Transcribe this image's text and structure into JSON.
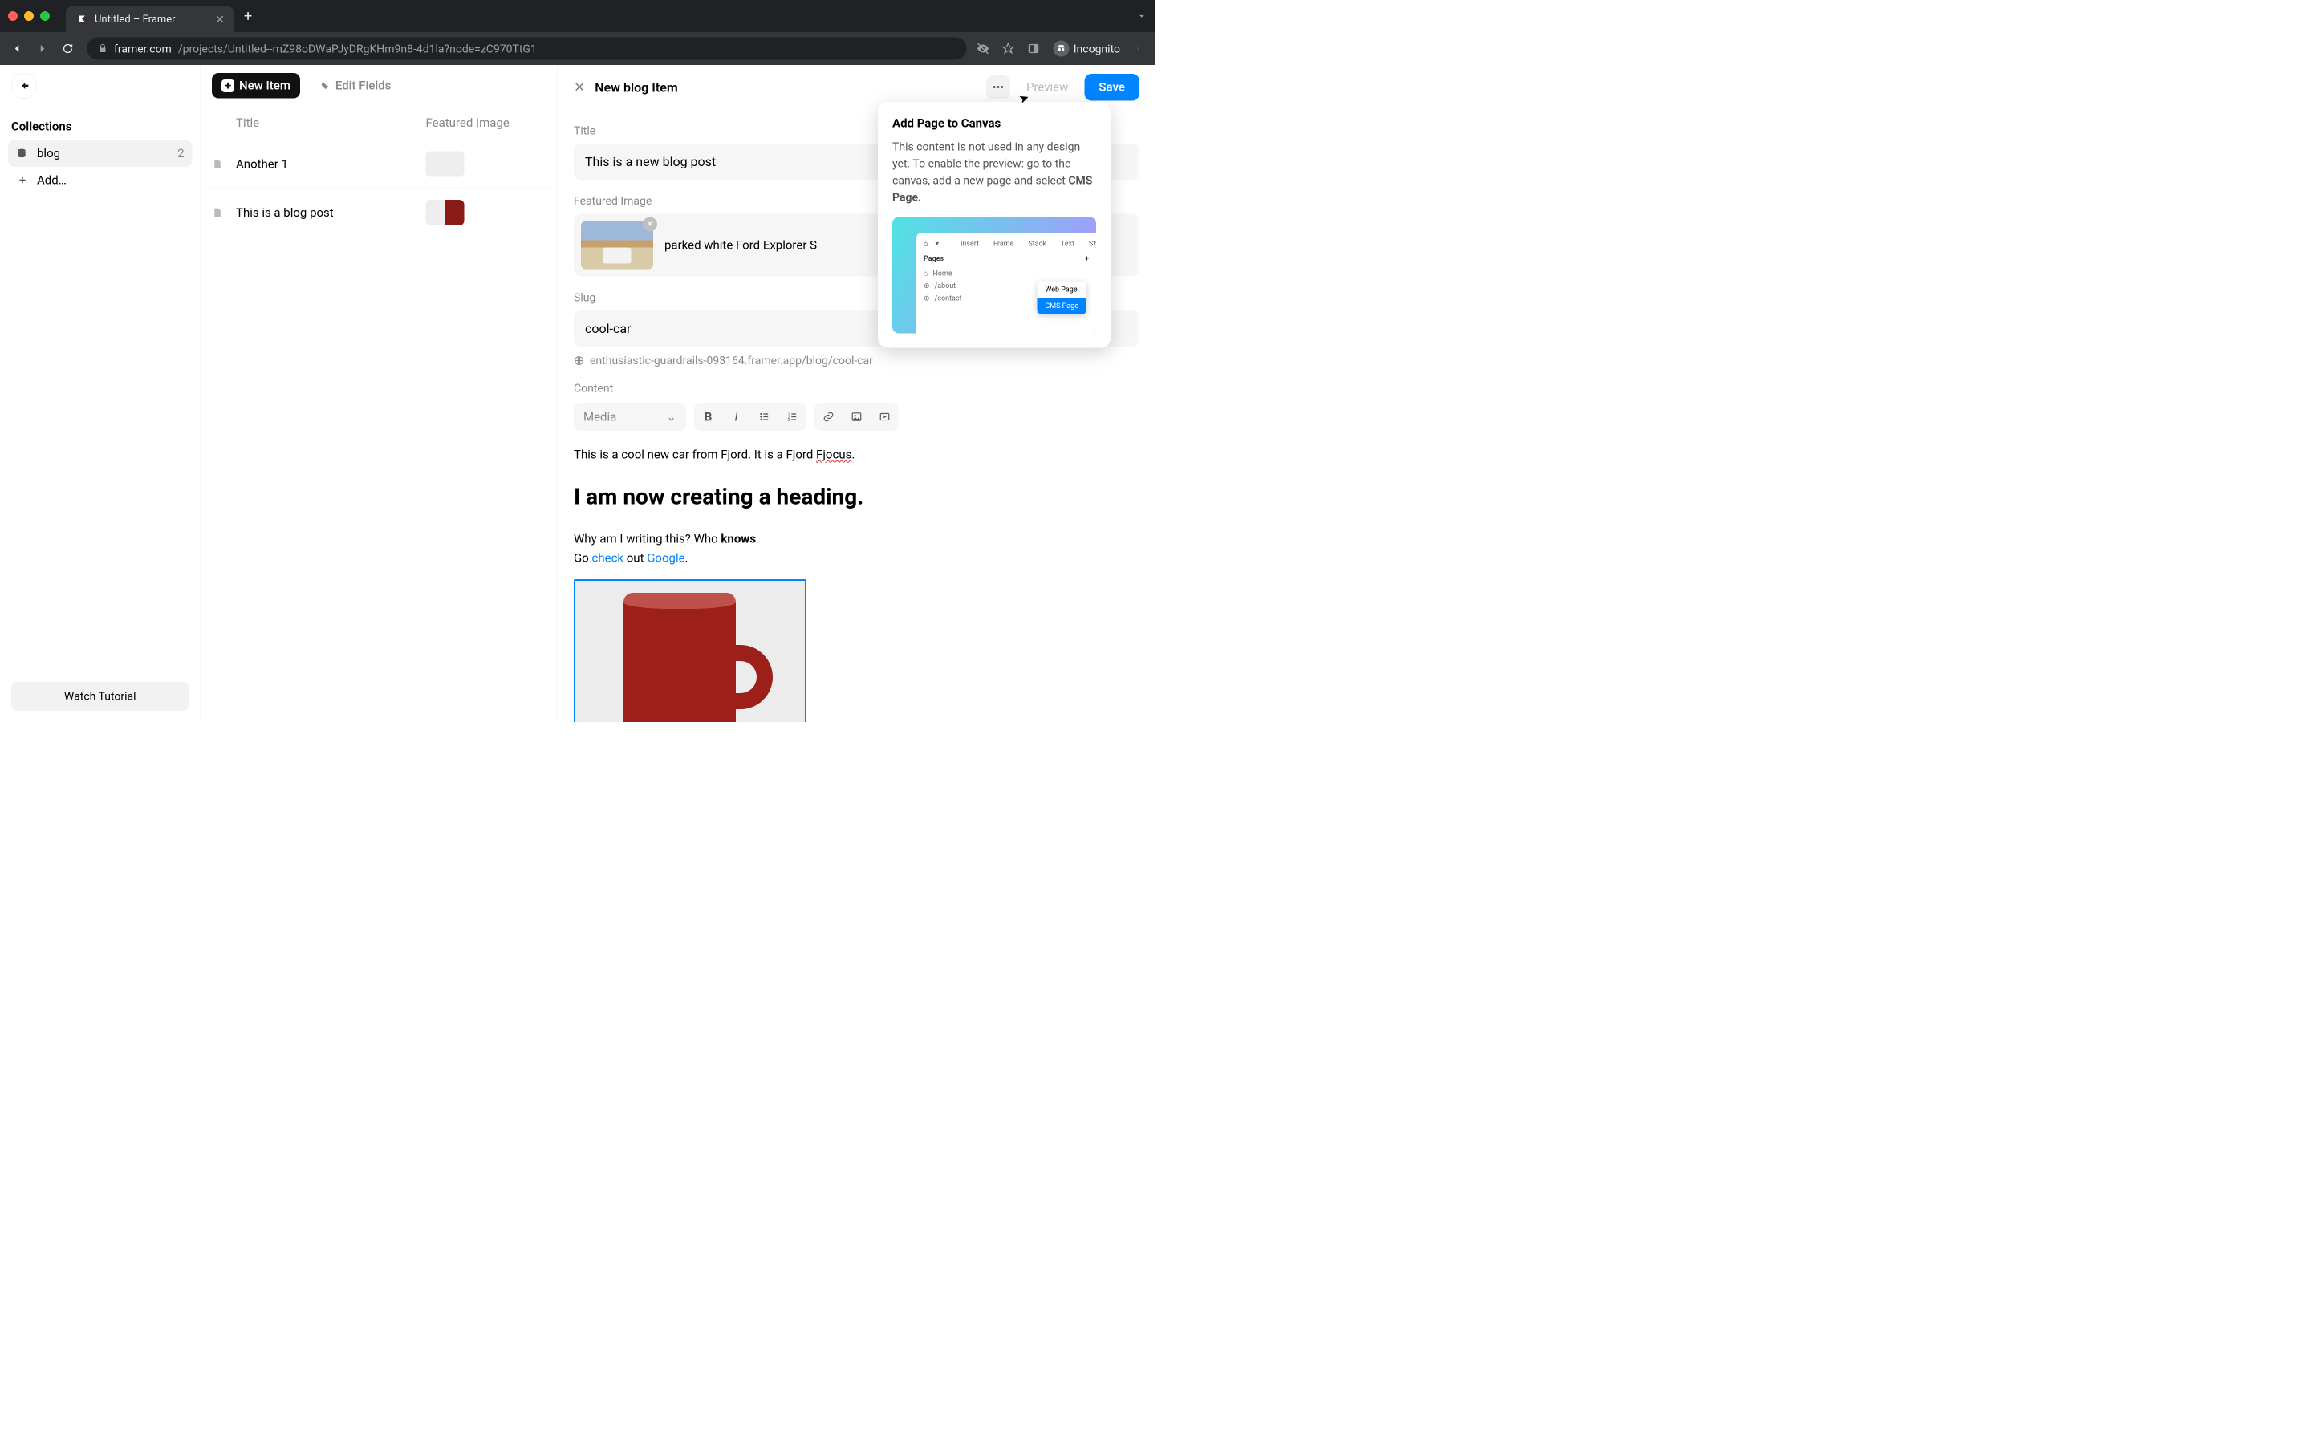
{
  "browser": {
    "tab_title": "Untitled – Framer",
    "url_host": "framer.com",
    "url_path": "/projects/Untitled--mZ98oDWaPJyDRgKHm9n8-4d1la?node=zC970TtG1",
    "incognito_label": "Incognito"
  },
  "sidebar": {
    "back_icon": "arrow-left",
    "heading": "Collections",
    "items": [
      {
        "icon": "database",
        "label": "blog",
        "count": "2",
        "active": true
      },
      {
        "icon": "plus",
        "label": "Add…",
        "count": "",
        "active": false
      }
    ],
    "tutorial_button": "Watch Tutorial"
  },
  "list": {
    "new_item_label": "New Item",
    "edit_fields_label": "Edit Fields",
    "columns": {
      "title": "Title",
      "featured_image": "Featured Image"
    },
    "rows": [
      {
        "title": "Another 1",
        "thumb": "blank"
      },
      {
        "title": "This is a blog post",
        "thumb": "mug"
      }
    ]
  },
  "editor": {
    "panel_title": "New blog Item",
    "preview_label": "Preview",
    "save_label": "Save",
    "fields": {
      "title_label": "Title",
      "title_value": "This is a new blog post",
      "featured_image_label": "Featured Image",
      "featured_image_caption": "parked white Ford Explorer S",
      "slug_label": "Slug",
      "slug_value": "cool-car",
      "slug_url": "enthusiastic-guardrails-093164.framer.app/blog/cool-car",
      "content_label": "Content"
    },
    "content_toolbar": {
      "media_label": "Media"
    },
    "content_body": {
      "p1_a": "This is a cool new car from Fjord. It is a Fjord ",
      "p1_err": "Fjocus",
      "p1_b": ".",
      "h2": "I am now creating a heading.",
      "p2_a": "Why am I writing this? Who ",
      "p2_b": "knows",
      "p2_c": ".",
      "p3_a": "Go ",
      "p3_link1": "check",
      "p3_b": " out ",
      "p3_link2": "Google",
      "p3_c": "."
    }
  },
  "popover": {
    "title": "Add Page to Canvas",
    "body_a": "This content is not used in any design yet. To enable the preview: go to the canvas, add a new page and select ",
    "body_b": "CMS Page.",
    "hint": {
      "toolbar": [
        "Insert",
        "Frame",
        "Stack",
        "Text",
        "Sty"
      ],
      "pages_label": "Pages",
      "pages": [
        "Home",
        "/about",
        "/contact"
      ],
      "menu": [
        "Web Page",
        "CMS Page"
      ]
    }
  }
}
